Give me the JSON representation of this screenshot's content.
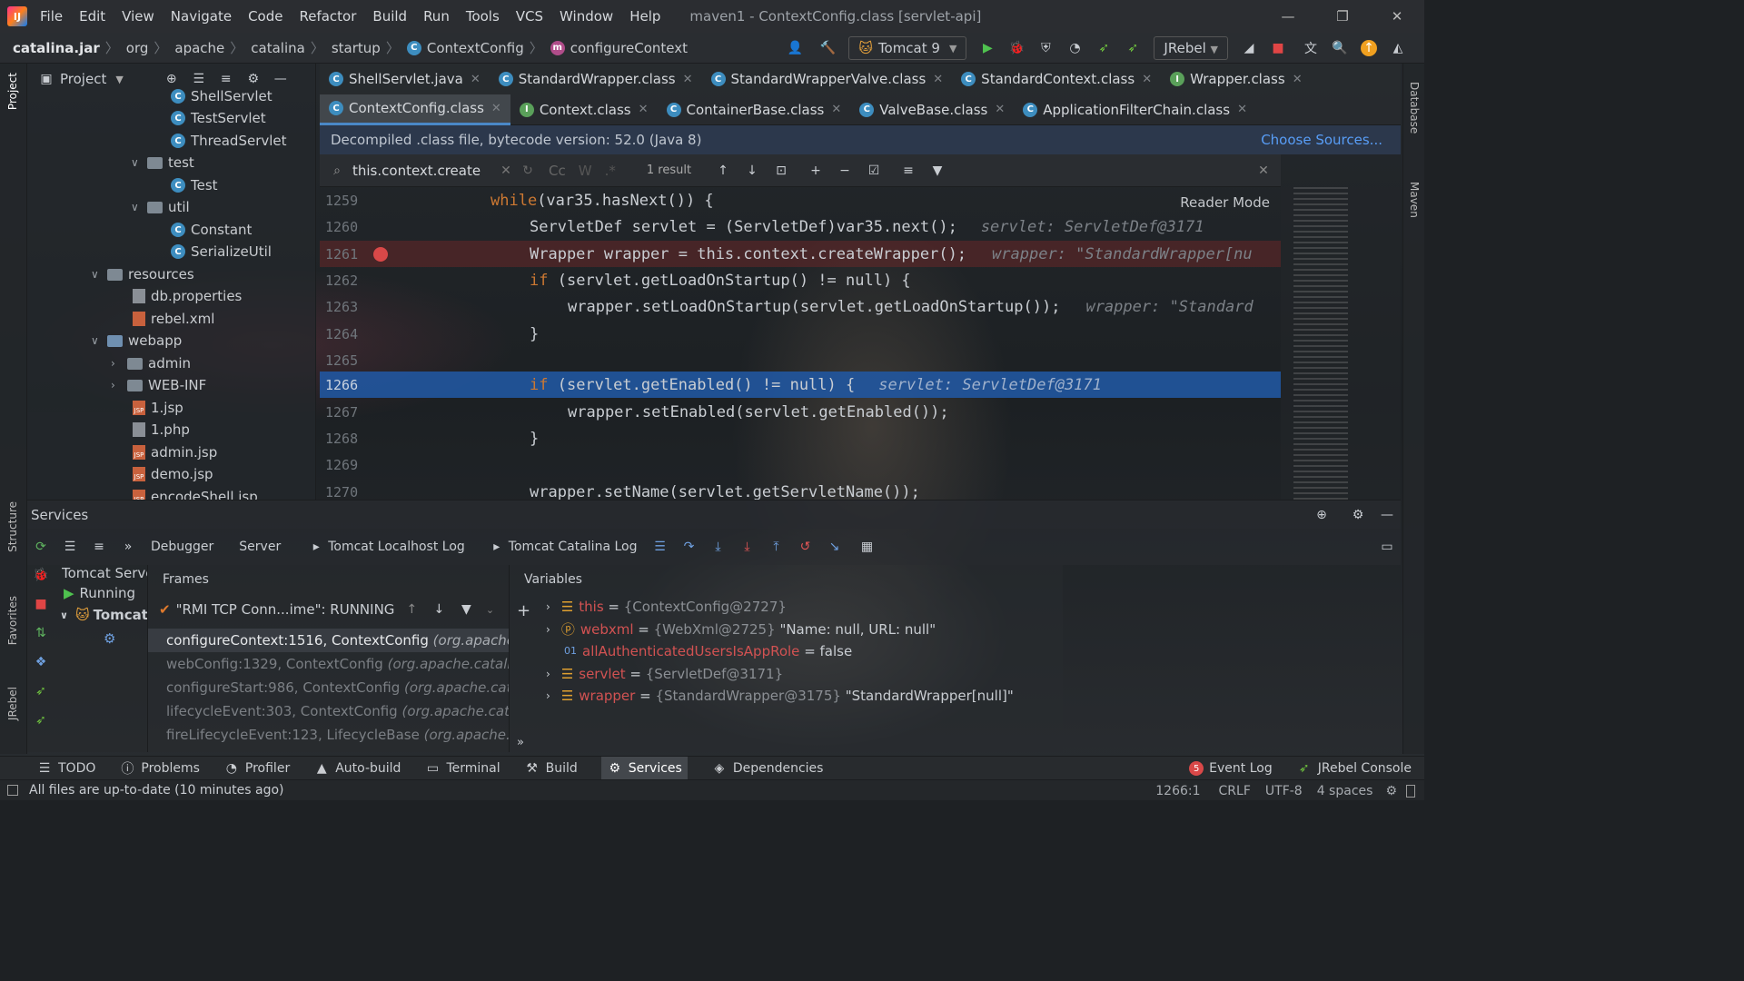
{
  "menubar": {
    "items": [
      "File",
      "Edit",
      "View",
      "Navigate",
      "Code",
      "Refactor",
      "Build",
      "Run",
      "Tools",
      "VCS",
      "Window",
      "Help"
    ],
    "window_title": "maven1 - ContextConfig.class [servlet-api]"
  },
  "navbar": {
    "breadcrumb": [
      "catalina.jar",
      "org",
      "apache",
      "catalina",
      "startup",
      "ContextConfig",
      "configureContext"
    ],
    "run_config": "Tomcat 9",
    "jrebel": "JRebel"
  },
  "project": {
    "header": "Project",
    "items": [
      {
        "label": "ShellServlet",
        "type": "class"
      },
      {
        "label": "TestServlet",
        "type": "class"
      },
      {
        "label": "ThreadServlet",
        "type": "class"
      },
      {
        "label": "test",
        "type": "folder"
      },
      {
        "label": "Test",
        "type": "class"
      },
      {
        "label": "util",
        "type": "folder"
      },
      {
        "label": "Constant",
        "type": "class"
      },
      {
        "label": "SerializeUtil",
        "type": "class"
      },
      {
        "label": "resources",
        "type": "folder"
      },
      {
        "label": "db.properties",
        "type": "file"
      },
      {
        "label": "rebel.xml",
        "type": "file"
      },
      {
        "label": "webapp",
        "type": "folder"
      },
      {
        "label": "admin",
        "type": "folder"
      },
      {
        "label": "WEB-INF",
        "type": "folder"
      },
      {
        "label": "1.jsp",
        "type": "file"
      },
      {
        "label": "1.php",
        "type": "file"
      },
      {
        "label": "admin.jsp",
        "type": "file"
      },
      {
        "label": "demo.jsp",
        "type": "file"
      },
      {
        "label": "encodeShell.jsp",
        "type": "file"
      }
    ]
  },
  "tabs_row1": [
    "ShellServlet.java",
    "StandardWrapper.class",
    "StandardWrapperValve.class",
    "StandardContext.class",
    "Wrapper.class"
  ],
  "tabs_row2": [
    "ContextConfig.class",
    "Context.class",
    "ContainerBase.class",
    "ValveBase.class",
    "ApplicationFilterChain.class"
  ],
  "banner": {
    "text": "Decompiled .class file, bytecode version: 52.0 (Java 8)",
    "link": "Choose Sources..."
  },
  "search": {
    "query": "this.context.create",
    "result": "1 result"
  },
  "reader_mode": "Reader Mode",
  "code": {
    "lines": [
      {
        "n": "1259",
        "kw": "while",
        "text": "(var35.hasNext()) {",
        "hint": ""
      },
      {
        "n": "1260",
        "kw": "",
        "text": "ServletDef servlet = (ServletDef)var35.next();",
        "hint": "servlet: ServletDef@3171"
      },
      {
        "n": "1261",
        "kw": "",
        "text": "Wrapper wrapper = this.context.createWrapper();",
        "hint": "wrapper: \"StandardWrapper[nu"
      },
      {
        "n": "1262",
        "kw": "if",
        "text": " (servlet.getLoadOnStartup() != null) {",
        "hint": ""
      },
      {
        "n": "1263",
        "kw": "",
        "text": "wrapper.setLoadOnStartup(servlet.getLoadOnStartup());",
        "hint": "wrapper: \"Standard"
      },
      {
        "n": "1264",
        "kw": "",
        "text": "}",
        "hint": ""
      },
      {
        "n": "1265",
        "kw": "",
        "text": "",
        "hint": ""
      },
      {
        "n": "1266",
        "kw": "if",
        "text": " (servlet.getEnabled() != null) {",
        "hint": "servlet: ServletDef@3171"
      },
      {
        "n": "1267",
        "kw": "",
        "text": "wrapper.setEnabled(servlet.getEnabled());",
        "hint": ""
      },
      {
        "n": "1268",
        "kw": "",
        "text": "}",
        "hint": ""
      },
      {
        "n": "1269",
        "kw": "",
        "text": "",
        "hint": ""
      },
      {
        "n": "1270",
        "kw": "",
        "text": "wrapper.setName(servlet.getServletName());",
        "hint": ""
      }
    ]
  },
  "services": {
    "title": "Services",
    "tabs": [
      "Debugger",
      "Server",
      "Tomcat Localhost Log",
      "Tomcat Catalina Log"
    ],
    "tree": [
      "Tomcat Server",
      "Running",
      "Tomcat"
    ],
    "frames_title": "Frames",
    "thread": "\"RMI TCP Conn...ime\": RUNNING",
    "frames": [
      {
        "method": "configureContext:1516, ContextConfig",
        "pkg": "(org.apache.ca"
      },
      {
        "method": "webConfig:1329, ContextConfig",
        "pkg": "(org.apache.catalina.s"
      },
      {
        "method": "configureStart:986, ContextConfig",
        "pkg": "(org.apache.catalin"
      },
      {
        "method": "lifecycleEvent:303, ContextConfig",
        "pkg": "(org.apache.catalina"
      },
      {
        "method": "fireLifecycleEvent:123, LifecycleBase",
        "pkg": "(org.apache.catal"
      }
    ],
    "variables_title": "Variables",
    "variables": [
      {
        "name": "this",
        "value": "{ContextConfig@2727}",
        "extra": ""
      },
      {
        "name": "webxml",
        "value": "{WebXml@2725}",
        "extra": "\"Name: null, URL: null\""
      },
      {
        "name": "allAuthenticatedUsersIsAppRole",
        "value": "false",
        "extra": ""
      },
      {
        "name": "servlet",
        "value": "{ServletDef@3171}",
        "extra": ""
      },
      {
        "name": "wrapper",
        "value": "{StandardWrapper@3175}",
        "extra": "\"StandardWrapper[null]\""
      }
    ]
  },
  "bottombar": {
    "left": [
      "TODO",
      "Problems",
      "Profiler",
      "Auto-build",
      "Terminal",
      "Build",
      "Services",
      "Dependencies"
    ],
    "right": [
      "Event Log",
      "JRebel Console"
    ],
    "event_count": "5"
  },
  "status": {
    "message": "All files are up-to-date (10 minutes ago)",
    "position": "1266:1",
    "line_sep": "CRLF",
    "encoding": "UTF-8",
    "indent": "4 spaces"
  },
  "strips": {
    "left": [
      "Project",
      "Structure",
      "Favorites",
      "JRebel"
    ],
    "right": [
      "Database",
      "Maven"
    ]
  },
  "colors": {
    "accent": "#4a88c7",
    "selection": "#2156a0",
    "keyword": "#cc7832",
    "var_name": "#d25252"
  }
}
